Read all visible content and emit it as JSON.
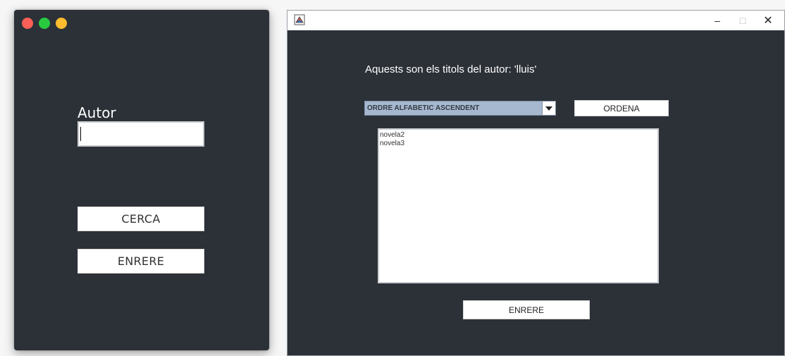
{
  "left_window": {
    "controls": {
      "close_color": "#fe5f57",
      "maximize_color": "#29c940",
      "minimize_color": "#febc2e"
    },
    "autor_label": "Autor",
    "autor_input_value": "",
    "cerca_button": "CERCA",
    "enrere_button": "ENRERE"
  },
  "right_window": {
    "titlebar": {
      "app_icon": "java-app-icon",
      "minimize": "–",
      "maximize": "□",
      "close": "✕"
    },
    "heading": "Aquests son els titols del autor: 'lluis'",
    "sort_select": {
      "selected": "ORDRE ALFABETIC ASCENDENT"
    },
    "ordena_button": "ORDENA",
    "titles": [
      "novela2",
      "novela3"
    ],
    "enrere_button": "ENRERE"
  },
  "colors": {
    "window_bg": "#2c3138",
    "combo_bg": "#a6b8cf"
  }
}
